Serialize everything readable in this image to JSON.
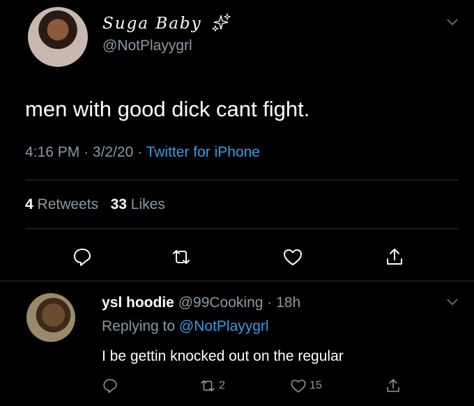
{
  "tweet": {
    "display_name": "Suga Baby",
    "handle": "@NotPlayygrl",
    "text": "men with good dick cant fight.",
    "time": "4:16 PM",
    "date": "3/2/20",
    "source": "Twitter for iPhone",
    "retweet_count": "4",
    "retweet_label": "Retweets",
    "like_count": "33",
    "like_label": "Likes",
    "icons": [
      "sparkle-icon",
      "chevron-down-icon",
      "reply-icon",
      "retweet-icon",
      "like-icon",
      "share-icon"
    ]
  },
  "reply": {
    "display_name": "ysl hoodie",
    "handle": "@99Cooking",
    "age": "18h",
    "replying_to_label": "Replying to",
    "replying_to_handle": "@NotPlayygrl",
    "text": "I be gettin knocked out on the regular",
    "retweet_count": "2",
    "like_count": "15"
  },
  "colors": {
    "background": "#000000",
    "primary_text": "#ffffff",
    "secondary_text": "#8b98a5",
    "link": "#3a9ae6",
    "divider": "#2f3336"
  }
}
